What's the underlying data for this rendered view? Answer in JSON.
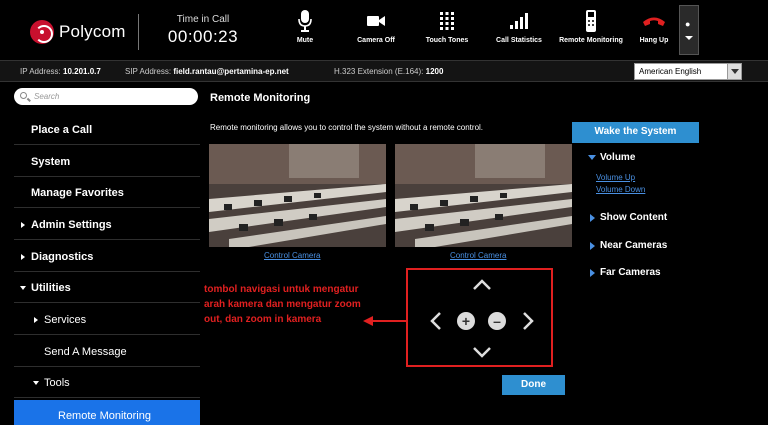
{
  "header": {
    "brand": "Polycom",
    "call_time_label": "Time in Call",
    "call_time_value": "00:00:23",
    "tools": [
      {
        "label": "Mute",
        "icon": "microphone-icon"
      },
      {
        "label": "Camera Off",
        "icon": "camera-icon"
      },
      {
        "label": "Touch Tones",
        "icon": "keypad-icon"
      },
      {
        "label": "Call Statistics",
        "icon": "signal-bars-icon"
      },
      {
        "label": "Remote Monitoring",
        "icon": "remote-control-icon"
      },
      {
        "label": "Hang Up",
        "icon": "hang-up-phone-icon"
      }
    ],
    "hangup_color": "#e02020"
  },
  "infobar": {
    "ip_label": "IP Address:",
    "ip_value": "10.201.0.7",
    "sip_label": "SIP Address:",
    "sip_value": "field.rantau@pertamina-ep.net",
    "h323_label": "H.323 Extension (E.164):",
    "h323_value": "1200",
    "language": "American English"
  },
  "sidebar": {
    "search_placeholder": "Search",
    "items": [
      {
        "label": "Place a Call"
      },
      {
        "label": "System"
      },
      {
        "label": "Manage Favorites"
      },
      {
        "label": "Admin Settings"
      },
      {
        "label": "Diagnostics"
      },
      {
        "label": "Utilities"
      },
      {
        "label": "Services"
      },
      {
        "label": "Send A Message"
      },
      {
        "label": "Tools"
      },
      {
        "label": "Remote Monitoring"
      }
    ]
  },
  "main": {
    "title": "Remote Monitoring",
    "description": "Remote monitoring allows you to control the system without a remote control.",
    "cameras": [
      {
        "link": "Control Camera"
      },
      {
        "link": "Control Camera"
      }
    ],
    "done_label": "Done"
  },
  "right_panel": {
    "wake_label": "Wake the System",
    "volume_label": "Volume",
    "volume_up": "Volume Up",
    "volume_down": "Volume Down",
    "show_content": "Show Content",
    "near_cameras": "Near Cameras",
    "far_cameras": "Far Cameras"
  },
  "annotation": {
    "text": "tombol navigasi untuk mengatur arah kamera dan mengatur zoom out, dan zoom in kamera",
    "color": "#e02020"
  },
  "colors": {
    "accent_blue": "#2e8fd0",
    "active_nav": "#1a73e8",
    "link_blue": "#4a90e2"
  }
}
